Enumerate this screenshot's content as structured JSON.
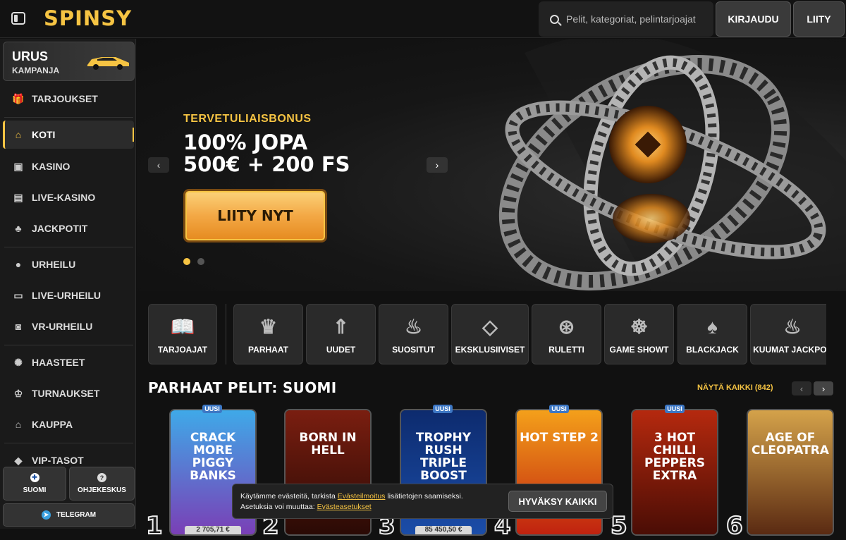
{
  "header": {
    "logo": "SPINSY",
    "search_placeholder": "Pelit, kategoriat, pelintarjoajat",
    "login_label": "KIRJAUDU",
    "join_label": "LIITY"
  },
  "sidebar": {
    "promo": {
      "title": "URUS",
      "subtitle": "KAMPANJA"
    },
    "items": [
      {
        "label": "TARJOUKSET",
        "icon": "gift-icon"
      },
      {
        "label": "KOTI",
        "icon": "home-icon",
        "active": true
      },
      {
        "label": "KASINO",
        "icon": "slot-machine-icon"
      },
      {
        "label": "LIVE-KASINO",
        "icon": "cards-icon"
      },
      {
        "label": "JACKPOTIT",
        "icon": "clover-icon"
      },
      {
        "label": "URHEILU",
        "icon": "ball-icon"
      },
      {
        "label": "LIVE-URHEILU",
        "icon": "live-icon"
      },
      {
        "label": "VR-URHEILU",
        "icon": "vr-icon"
      },
      {
        "label": "HAASTEET",
        "icon": "challenge-icon"
      },
      {
        "label": "TURNAUKSET",
        "icon": "trophy-icon"
      },
      {
        "label": "KAUPPA",
        "icon": "shop-icon"
      },
      {
        "label": "VIP-TASOT",
        "icon": "diamond-icon"
      }
    ],
    "language_label": "SUOMI",
    "help_label": "OHJEKESKUS",
    "telegram_label": "TELEGRAM"
  },
  "hero": {
    "subtitle": "TERVETULIAISBONUS",
    "title_line1": "100% JOPA",
    "title_line2": "500€ + 200 FS",
    "cta": "LIITY NYT",
    "active_slide": 1,
    "slide_count": 2
  },
  "categories": [
    {
      "label": "TARJOAJAT",
      "icon": "book-icon"
    },
    {
      "label": "PARHAAT",
      "icon": "crown-icon"
    },
    {
      "label": "UUDET",
      "icon": "rocket-icon"
    },
    {
      "label": "SUOSITUT",
      "icon": "flame-icon"
    },
    {
      "label": "EKSKLUSIIVISET",
      "icon": "diamond-icon"
    },
    {
      "label": "RULETTI",
      "icon": "roulette-icon"
    },
    {
      "label": "GAME SHOWT",
      "icon": "wheel-icon"
    },
    {
      "label": "BLACKJACK",
      "icon": "playing-card-icon"
    },
    {
      "label": "KUUMAT JACKPOT",
      "icon": "hot-pepper-icon"
    }
  ],
  "section": {
    "title": "PARHAAT PELIT: SUOMI",
    "see_all": "NÄYTÄ KAIKKI (842)"
  },
  "games": [
    {
      "name": "CRACK MORE PIGGY BANKS",
      "badge": "UUSI",
      "rank": "1",
      "price": "2 705,71 €",
      "color1": "#3fa9e8",
      "color2": "#7a3fb6"
    },
    {
      "name": "BORN IN HELL",
      "badge": "",
      "rank": "2",
      "price": "",
      "color1": "#7a1e10",
      "color2": "#2a0a05"
    },
    {
      "name": "TROPHY RUSH TRIPLE BOOST",
      "badge": "UUSI",
      "rank": "3",
      "price": "85 450,50 €",
      "color1": "#0d2b6e",
      "color2": "#1b4da8"
    },
    {
      "name": "HOT STEP 2",
      "badge": "UUSI",
      "rank": "4",
      "price": "",
      "color1": "#f4a01a",
      "color2": "#c0220f"
    },
    {
      "name": "3 HOT CHILLI PEPPERS EXTRA",
      "badge": "UUSI",
      "rank": "5",
      "price": "",
      "color1": "#b5290e",
      "color2": "#4a0d05"
    },
    {
      "name": "AGE OF CLEOPATRA",
      "badge": "",
      "rank": "6",
      "price": "",
      "color1": "#d4a24a",
      "color2": "#5a2a12"
    }
  ],
  "cookie": {
    "text1": "Käytämme evästeitä, tarkista ",
    "link1": "Evästeilmoitus",
    "text2": " lisätietojen saamiseksi.",
    "text3": "Asetuksia voi muuttaa: ",
    "link2": "Evästeasetukset",
    "accept": "HYVÄKSY KAIKKI"
  },
  "colors": {
    "accent": "#f6c443",
    "background": "#111111",
    "badge": "#3d77c4"
  }
}
